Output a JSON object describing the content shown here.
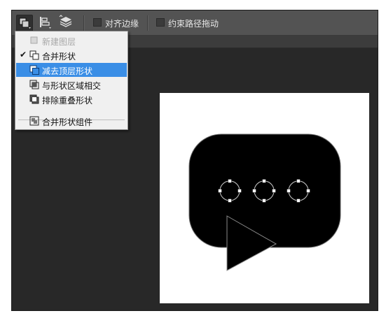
{
  "toolbar": {
    "path_ops_icon": "combine-shapes-icon",
    "align_icon": "path-alignment-icon",
    "arrange_icon": "path-arrangement-icon",
    "align_edges_label": "对齐边缘",
    "constrain_path_label": "约束路径拖动"
  },
  "menu": {
    "items": [
      {
        "label": "新建图层",
        "icon": "new-layer-icon",
        "disabled": true,
        "checked": false,
        "highlighted": false
      },
      {
        "label": "合并形状",
        "icon": "combine-shapes-icon",
        "disabled": false,
        "checked": true,
        "highlighted": false
      },
      {
        "label": "减去顶层形状",
        "icon": "subtract-front-shape-icon",
        "disabled": false,
        "checked": false,
        "highlighted": true
      },
      {
        "label": "与形状区域相交",
        "icon": "intersect-shape-areas-icon",
        "disabled": false,
        "checked": false,
        "highlighted": false
      },
      {
        "label": "排除重叠形状",
        "icon": "exclude-overlapping-shapes-icon",
        "disabled": false,
        "checked": false,
        "highlighted": false
      },
      {
        "label": "合并形状组件",
        "icon": "merge-shape-components-icon",
        "disabled": false,
        "checked": false,
        "highlighted": false
      }
    ],
    "check_glyph": "✔"
  },
  "colors": {
    "toolbar_bg": "#535353",
    "workspace_bg": "#282828",
    "menu_bg": "#f0f0f0",
    "highlight": "#3a8ee6",
    "shape_fill": "#000000"
  }
}
